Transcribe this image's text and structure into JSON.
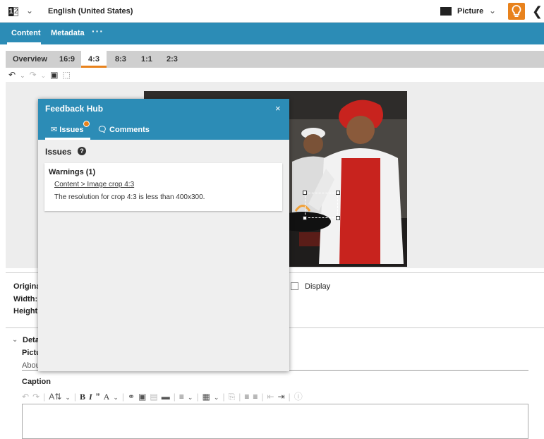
{
  "topbar": {
    "lang_icon_1": "1",
    "lang_icon_2": "2",
    "language": "English (United States)",
    "type_label": "Picture",
    "accent": "#e8821c"
  },
  "tabs": {
    "content": "Content",
    "metadata": "Metadata",
    "more": "···",
    "color": "#2c8cb6"
  },
  "crops": {
    "overview": "Overview",
    "r169": "16:9",
    "r43": "4:3",
    "r83": "8:3",
    "r11": "1:1",
    "r23": "2:3"
  },
  "info": {
    "original": "Original",
    "width": "Width:",
    "height": "Height:",
    "display": "Display"
  },
  "details": {
    "section": "Detai",
    "picture_label": "Pictu",
    "picture_value": "Abou",
    "caption_label": "Caption"
  },
  "hub": {
    "title": "Feedback Hub",
    "close": "×",
    "issues_tab": "Issues",
    "comments_tab": "Comments",
    "issues_heading": "Issues",
    "help": "?",
    "warnings": "Warnings (1)",
    "link": "Content > Image crop 4:3",
    "message": "The resolution for crop 4:3 is less than 400x300."
  }
}
